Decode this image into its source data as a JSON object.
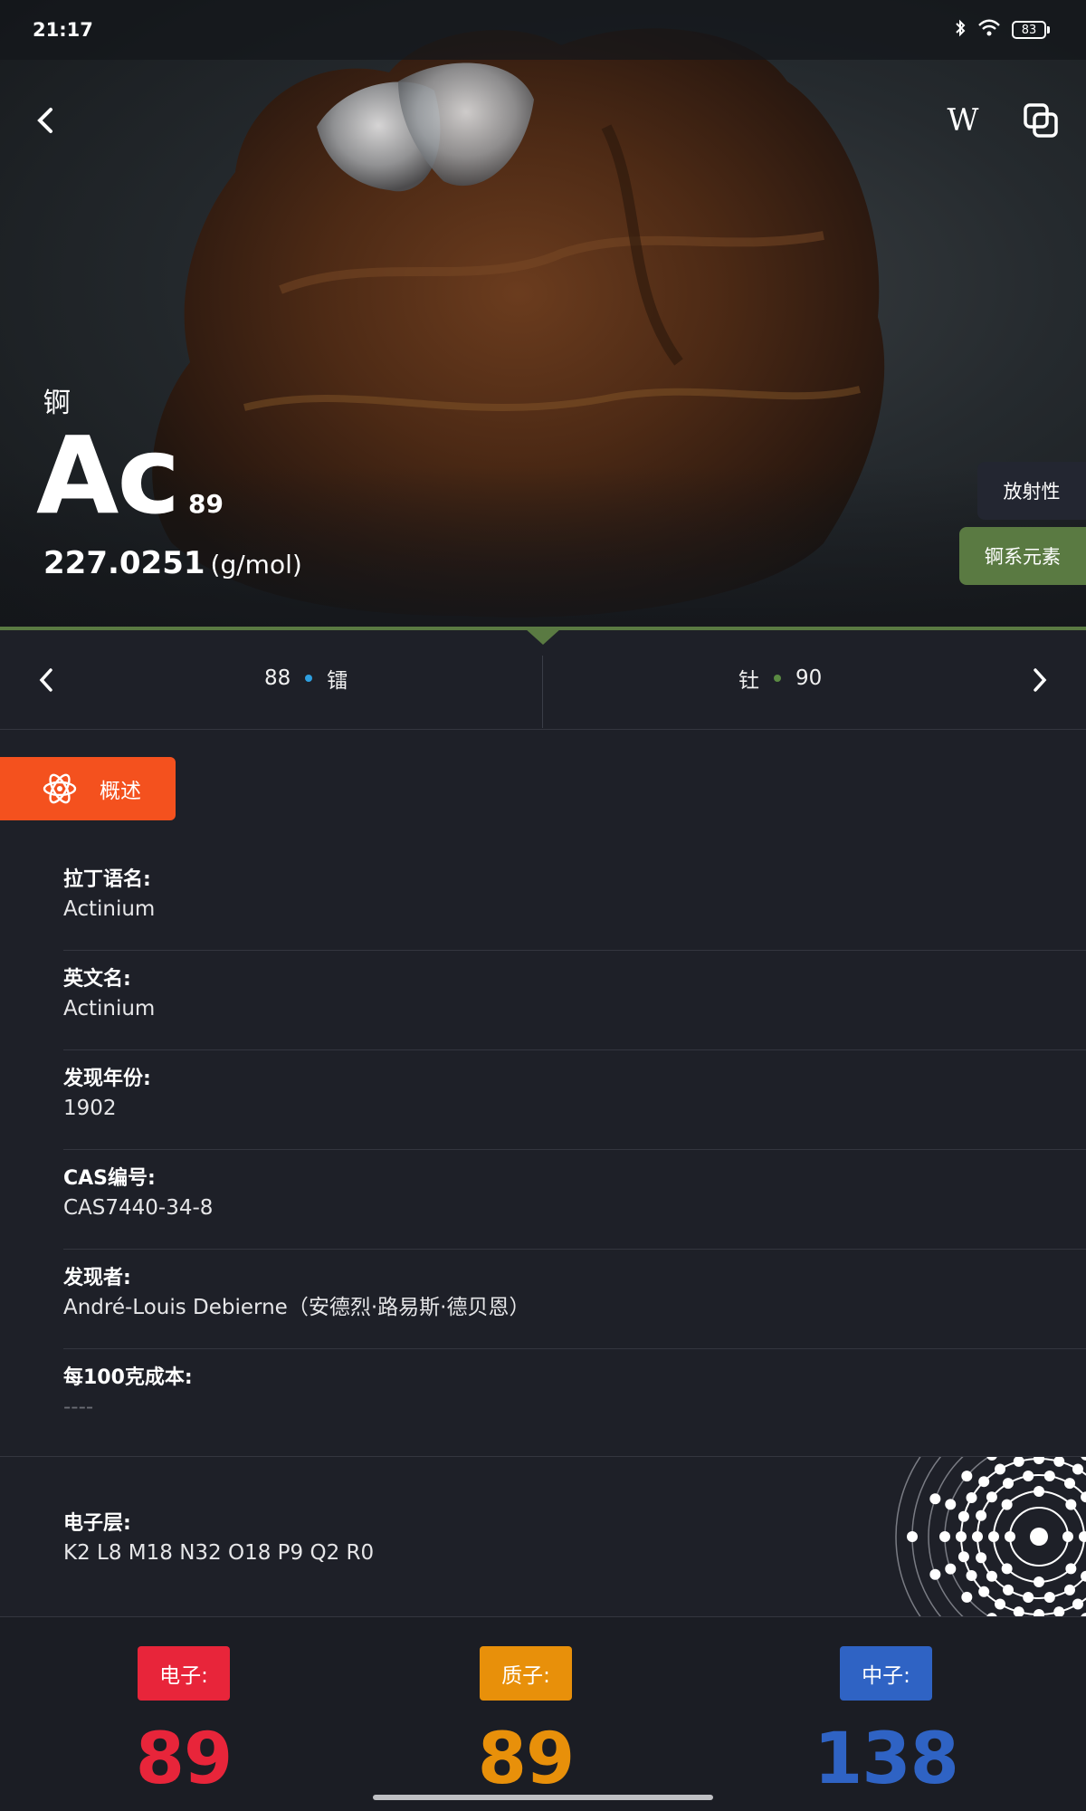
{
  "status_bar": {
    "time": "21:17",
    "battery": "83"
  },
  "element": {
    "name_cn": "锕",
    "symbol": "Ac",
    "atomic_number": "89",
    "mass": "227.0251",
    "mass_unit": "(g/mol)",
    "tags": [
      "放射性",
      "锕系元素"
    ]
  },
  "header": {
    "wiki_label": "W"
  },
  "nav": {
    "prev": {
      "number": "88",
      "name": "镭",
      "dot_color": "#2e9fe0"
    },
    "next": {
      "name": "钍",
      "number": "90",
      "dot_color": "#5a8a42"
    }
  },
  "tab": {
    "overview_label": "概述"
  },
  "info": [
    {
      "label": "拉丁语名:",
      "value": "Actinium"
    },
    {
      "label": "英文名:",
      "value": "Actinium"
    },
    {
      "label": "发现年份:",
      "value": "1902"
    },
    {
      "label": "CAS编号:",
      "value": "CAS7440-34-8"
    },
    {
      "label": "发现者:",
      "value": "André-Louis Debierne（安德烈·路易斯·德贝恩）"
    },
    {
      "label": "每100克成本:",
      "value": "----"
    }
  ],
  "shells": {
    "label": "电子层:",
    "value": "K2 L8 M18 N32 O18 P9 Q2 R0"
  },
  "particles": {
    "electron": {
      "label": "电子:",
      "value": "89",
      "color": "#e8253a"
    },
    "proton": {
      "label": "质子:",
      "value": "89",
      "color": "#e8900a"
    },
    "neutron": {
      "label": "中子:",
      "value": "138",
      "color": "#2f63c4"
    }
  }
}
